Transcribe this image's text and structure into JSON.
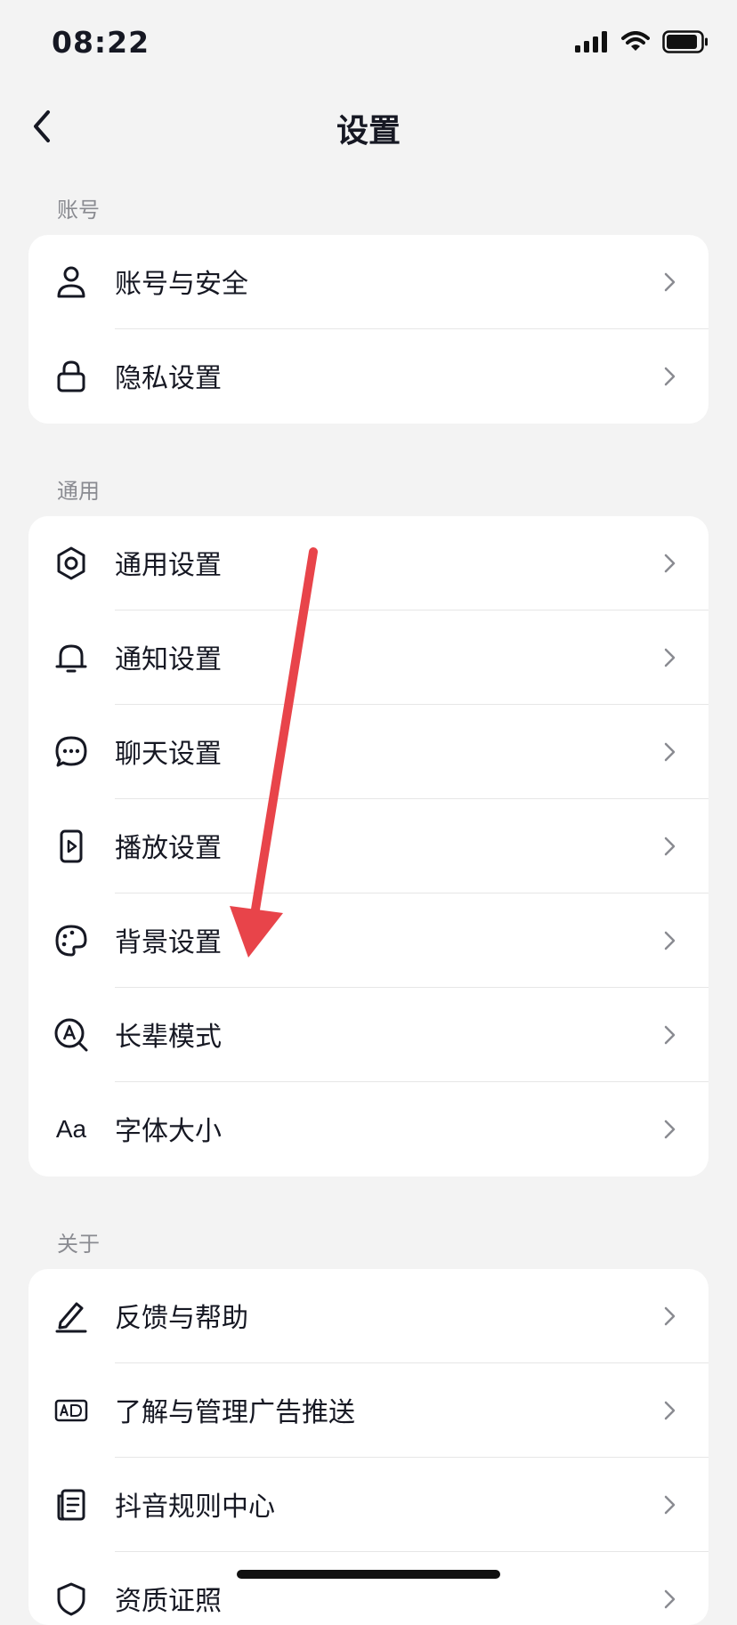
{
  "status": {
    "time": "08:22"
  },
  "header": {
    "title": "设置"
  },
  "sections": [
    {
      "title": "账号",
      "items": [
        "账号与安全",
        "隐私设置"
      ]
    },
    {
      "title": "通用",
      "items": [
        "通用设置",
        "通知设置",
        "聊天设置",
        "播放设置",
        "背景设置",
        "长辈模式",
        "字体大小"
      ]
    },
    {
      "title": "关于",
      "items": [
        "反馈与帮助",
        "了解与管理广告推送",
        "抖音规则中心",
        "资质证照"
      ]
    }
  ],
  "icons": {
    "font_size_glyph": "Aa"
  },
  "colors": {
    "background": "#f3f3f3",
    "card": "#ffffff",
    "text": "#161823",
    "section_title": "#8a8b91",
    "annotation_arrow": "#e8444a"
  }
}
